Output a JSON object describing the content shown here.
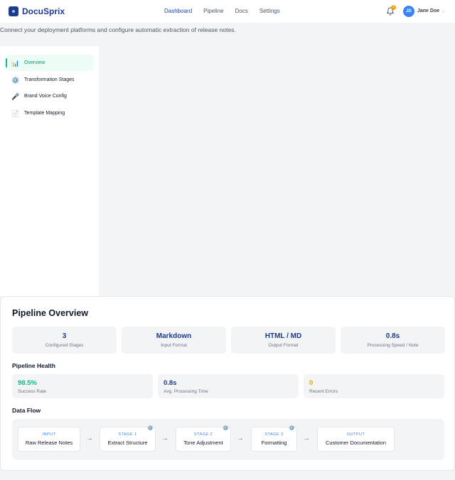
{
  "brand": {
    "name": "DocuSprix"
  },
  "nav": [
    "Dashboard",
    "Pipeline",
    "Docs",
    "Settings"
  ],
  "notifications": {
    "count": "2"
  },
  "user": {
    "initials": "JD",
    "name": "Jane Doe"
  },
  "subtitle": "Connect your deployment platforms and configure automatic extraction of release notes.",
  "sidebar": {
    "items": [
      {
        "label": "Overview",
        "icon": "bar-chart-icon",
        "glyph": "📊",
        "active": true
      },
      {
        "label": "Transformation Stages",
        "icon": "gear-icon",
        "glyph": "⚙️",
        "active": false
      },
      {
        "label": "Brand Voice Config",
        "icon": "microphone-icon",
        "glyph": "🎤",
        "active": false
      },
      {
        "label": "Template Mapping",
        "icon": "document-icon",
        "glyph": "📄",
        "active": false
      }
    ]
  },
  "overview": {
    "title": "Pipeline Overview",
    "stats": [
      {
        "value": "3",
        "label": "Configured Stages"
      },
      {
        "value": "Markdown",
        "label": "Input Format"
      },
      {
        "value": "HTML / MD",
        "label": "Output Format"
      },
      {
        "value": "0.8s",
        "label": "Processing Speed / Note"
      }
    ],
    "health_title": "Pipeline Health",
    "health": [
      {
        "value": "98.5%",
        "label": "Success Rate",
        "color": "#10b981"
      },
      {
        "value": "0.8s",
        "label": "Avg. Processing Time",
        "color": "#1e3a8a"
      },
      {
        "value": "0",
        "label": "Recent Errors",
        "color": "#f59e0b"
      }
    ],
    "flow_title": "Data Flow",
    "flow": [
      {
        "kicker": "INPUT",
        "title": "Raw Release Notes",
        "gear": false
      },
      {
        "kicker": "STAGE 1",
        "title": "Extract Structure",
        "gear": true
      },
      {
        "kicker": "STAGE 2",
        "title": "Tone Adjustment",
        "gear": true
      },
      {
        "kicker": "STAGE 3",
        "title": "Formatting",
        "gear": true
      },
      {
        "kicker": "OUTPUT",
        "title": "Customer Documentation",
        "gear": false
      }
    ],
    "flow_arrow": "→"
  },
  "colors": {
    "brand": "#1e3a8a",
    "accent": "#10b981",
    "warning": "#f59e0b"
  }
}
